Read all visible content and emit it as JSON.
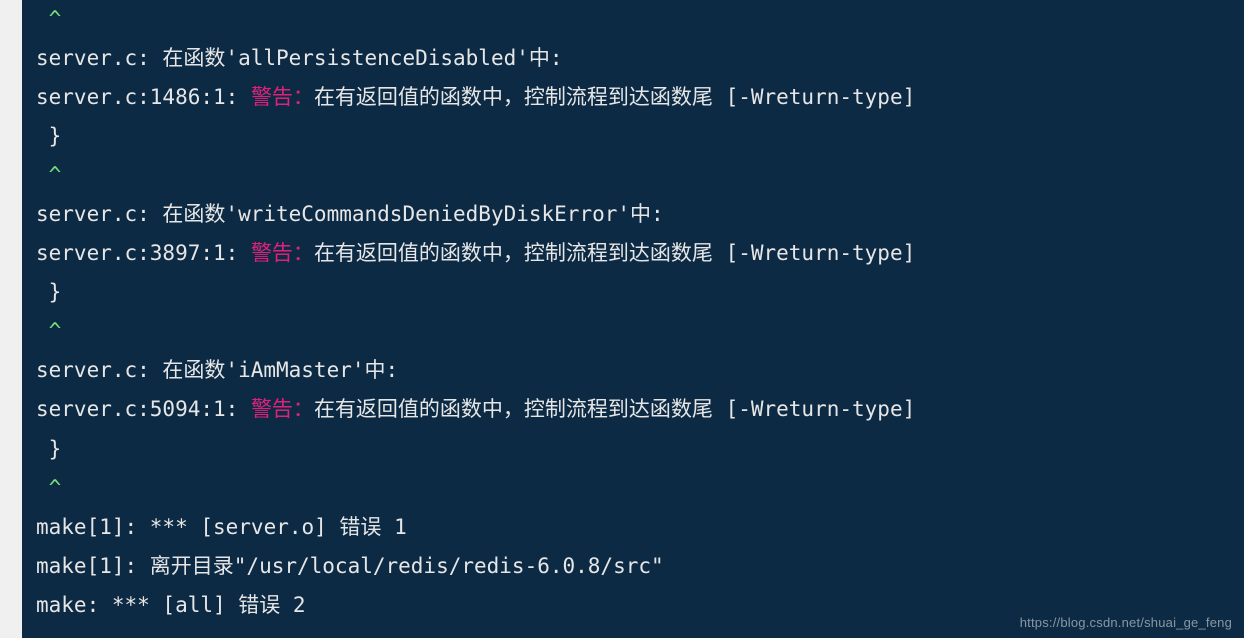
{
  "terminal": {
    "lines": [
      {
        "type": "caret"
      },
      {
        "type": "ctx",
        "prefix": "server.c: 在函数'",
        "name": "allPersistenceDisabled",
        "suffix": "'中:"
      },
      {
        "type": "warn",
        "loc": "server.c:1486:1: ",
        "label": "警告：",
        "msg": "在有返回值的函数中，控制流程到达函数尾 [-Wreturn-type]"
      },
      {
        "type": "plain",
        "text": " }"
      },
      {
        "type": "caret"
      },
      {
        "type": "ctx",
        "prefix": "server.c: 在函数'",
        "name": "writeCommandsDeniedByDiskError",
        "suffix": "'中:"
      },
      {
        "type": "warn",
        "loc": "server.c:3897:1: ",
        "label": "警告：",
        "msg": "在有返回值的函数中，控制流程到达函数尾 [-Wreturn-type]"
      },
      {
        "type": "plain",
        "text": " }"
      },
      {
        "type": "caret"
      },
      {
        "type": "ctx",
        "prefix": "server.c: 在函数'",
        "name": "iAmMaster",
        "suffix": "'中:"
      },
      {
        "type": "warn",
        "loc": "server.c:5094:1: ",
        "label": "警告：",
        "msg": "在有返回值的函数中，控制流程到达函数尾 [-Wreturn-type]"
      },
      {
        "type": "plain",
        "text": " }"
      },
      {
        "type": "caret"
      },
      {
        "type": "plain",
        "text": "make[1]: *** [server.o] 错误 1"
      },
      {
        "type": "plain",
        "text": "make[1]: 离开目录\"/usr/local/redis/redis-6.0.8/src\""
      },
      {
        "type": "plain",
        "text": "make: *** [all] 错误 2"
      }
    ],
    "caret_glyph": " ^"
  },
  "watermark": "https://blog.csdn.net/shuai_ge_feng"
}
